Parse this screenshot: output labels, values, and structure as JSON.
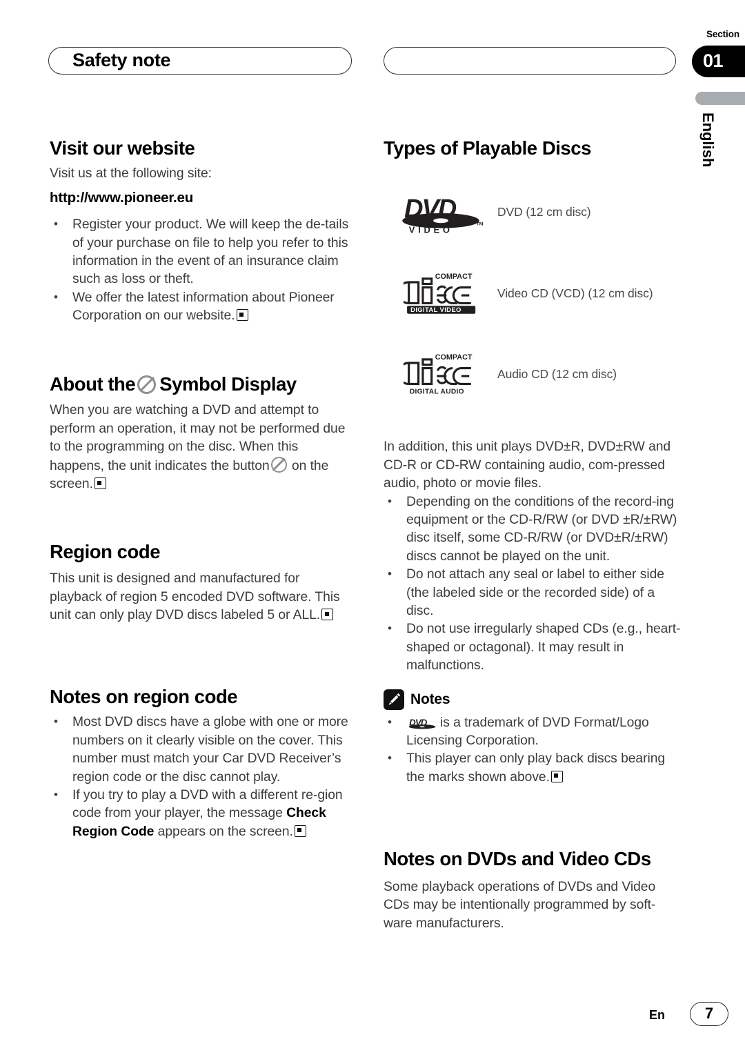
{
  "header": {
    "left_pill_title": "Safety note",
    "right_pill_title": "",
    "section_label": "Section",
    "section_number": "01",
    "language_tab": "English"
  },
  "left_column": {
    "website": {
      "heading": "Visit our website",
      "intro": "Visit us at the following site:",
      "url": "http://www.pioneer.eu",
      "bullets": [
        "Register your product. We will keep the de-tails of your purchase on file to help you refer to this information in the event of an insurance claim such as loss or theft.",
        "We offer the latest information about Pioneer Corporation on our website."
      ]
    },
    "symbol_display": {
      "heading_before": "About the",
      "heading_after": "Symbol Display",
      "body_1": "When you are watching a DVD and attempt to perform an operation, it may not be performed due to the programming on the disc. When this happens, the unit indicates the button",
      "body_2": "on the screen."
    },
    "region_code": {
      "heading": "Region code",
      "body": "This unit is designed and manufactured for playback of region 5 encoded DVD software. This unit can only play DVD discs labeled 5 or ALL."
    },
    "notes_on_region_code": {
      "heading": "Notes on region code",
      "bullet_1": "Most DVD discs have a globe with one or more numbers on it clearly visible on the cover. This number must match your Car DVD Receiver’s region code or the disc cannot play.",
      "bullet_2_a": "If you try to play a DVD with a different re-gion code from your player, the message",
      "bullet_2_bold": "Check Region Code",
      "bullet_2_b": "appears on the screen."
    }
  },
  "right_column": {
    "playable_discs": {
      "heading": "Types of Playable Discs",
      "rows": [
        {
          "logo": "dvd-video-logo",
          "label": "DVD (12 cm disc)"
        },
        {
          "logo": "compact-disc-digital-video-logo",
          "label": "Video CD (VCD) (12 cm disc)"
        },
        {
          "logo": "compact-disc-digital-audio-logo",
          "label": "Audio CD (12 cm disc)"
        }
      ],
      "intro": "In addition, this unit plays DVD±R, DVD±RW and CD-R or CD-RW containing audio, com-pressed audio, photo or movie files.",
      "bullets": [
        "Depending on the conditions of the record-ing equipment or the CD-R/RW (or DVD ±R/±RW) disc itself, some CD-R/RW (or DVD±R/±RW) discs cannot be played on the unit.",
        "Do not attach any seal or label to either side (the labeled side or the recorded side) of a disc.",
        "Do not use irregularly shaped CDs (e.g., heart-shaped or octagonal). It may result in malfunctions."
      ]
    },
    "notes": {
      "title": "Notes",
      "bullet_1": "is a trademark of DVD Format/Logo Licensing Corporation.",
      "bullet_2": "This player can only play back discs bearing the marks shown above."
    },
    "notes_dvds_vcds": {
      "heading": "Notes on DVDs and Video CDs",
      "body": "Some playback operations of DVDs and Video CDs may be intentionally programmed by soft-ware manufacturers."
    }
  },
  "footer": {
    "language_code": "En",
    "page_number": "7"
  },
  "logo_text": {
    "dvd": "DVD",
    "video": "VIDEO",
    "tm": "TM",
    "compact": "COMPACT",
    "disc": "disc",
    "digital_video": "DIGITAL VIDEO",
    "digital_audio": "DIGITAL AUDIO"
  }
}
